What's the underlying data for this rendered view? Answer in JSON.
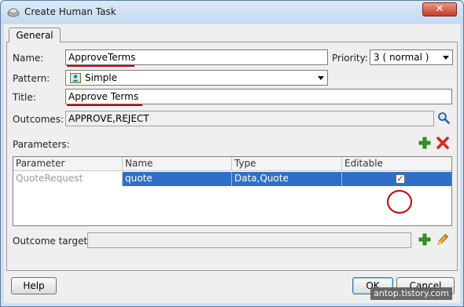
{
  "window": {
    "title": "Create Human Task",
    "close_label": "✕"
  },
  "tabs": [
    {
      "label": "General"
    }
  ],
  "form": {
    "name_label": "Name:",
    "name_value": "ApproveTerms",
    "priority_label": "Priority:",
    "priority_value": "3 ( normal )",
    "pattern_label": "Pattern:",
    "pattern_value": "Simple",
    "title_label": "Title:",
    "title_value": "Approve Terms",
    "outcomes_label": "Outcomes:",
    "outcomes_value": "APPROVE,REJECT",
    "parameters_label": "Parameters:",
    "outcome_target_label": "Outcome target:",
    "outcome_target_value": ""
  },
  "table": {
    "columns": [
      "Parameter",
      "Name",
      "Type",
      "Editable"
    ],
    "rows": [
      {
        "parameter": "QuoteRequest",
        "name": "quote",
        "type": "Data,Quote",
        "editable": true
      }
    ]
  },
  "buttons": {
    "help": "Help",
    "ok": "OK",
    "cancel": "Cancel"
  },
  "watermark": "antop.tistory.com",
  "colors": {
    "selection": "#2f6fc6",
    "annotation": "#c00000",
    "add_icon": "#2a9d1a",
    "remove_icon": "#d42a1a"
  }
}
